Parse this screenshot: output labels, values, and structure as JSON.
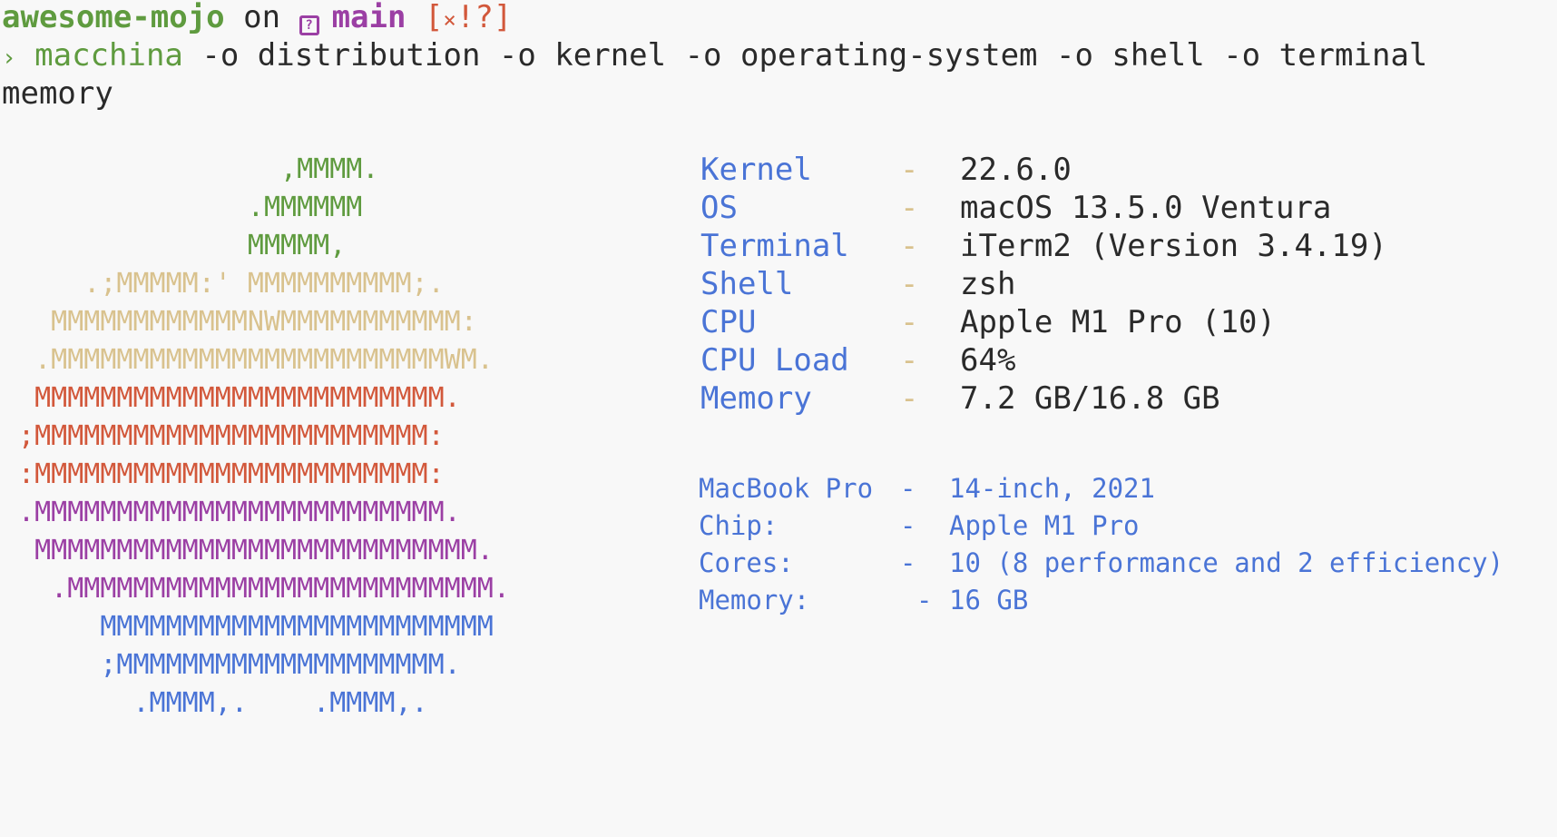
{
  "prompt": {
    "directory": "awesome-mojo",
    "on_word": "on",
    "branch_icon": "git-branch-question-icon",
    "branch_icon_glyph": "?",
    "branch": "main",
    "status_open": "[",
    "status_x": "×",
    "status_flags": "!?",
    "status_close": "]",
    "prompt_symbol": "›",
    "command": "macchina",
    "args_line1": " -o distribution -o kernel -o operating-system -o shell -o terminal",
    "args_line2": "memory"
  },
  "ascii_art": [
    {
      "text": "                 ,MMMM.",
      "color": "green"
    },
    {
      "text": "               .MMMMMM",
      "color": "green"
    },
    {
      "text": "               MMMMM,",
      "color": "green"
    },
    {
      "text": "     .;MMMMM:' MMMMMMMMMM;.",
      "color": "yellow"
    },
    {
      "text": "   MMMMMMMMMMMMNWMMMMMMMMMMM:",
      "color": "yellow"
    },
    {
      "text": "  .MMMMMMMMMMMMMMMMMMMMMMMMWM.",
      "color": "yellow"
    },
    {
      "text": "  MMMMMMMMMMMMMMMMMMMMMMMMM.",
      "color": "red"
    },
    {
      "text": " ;MMMMMMMMMMMMMMMMMMMMMMMM:",
      "color": "red"
    },
    {
      "text": " :MMMMMMMMMMMMMMMMMMMMMMMM:",
      "color": "red"
    },
    {
      "text": " .MMMMMMMMMMMMMMMMMMMMMMMMM.",
      "color": "purple"
    },
    {
      "text": "  MMMMMMMMMMMMMMMMMMMMMMMMMMM.",
      "color": "purple"
    },
    {
      "text": "   .MMMMMMMMMMMMMMMMMMMMMMMMMM.",
      "color": "purple"
    },
    {
      "text": "      MMMMMMMMMMMMMMMMMMMMMMMM",
      "color": "blue"
    },
    {
      "text": "      ;MMMMMMMMMMMMMMMMMMMM.",
      "color": "blue"
    },
    {
      "text": "        .MMMM,.    .MMMM,.",
      "color": "blue"
    }
  ],
  "info": [
    {
      "key": "Kernel",
      "sep": "-",
      "value": "22.6.0"
    },
    {
      "key": "OS",
      "sep": "-",
      "value": "macOS 13.5.0 Ventura"
    },
    {
      "key": "Terminal",
      "sep": "-",
      "value": "iTerm2 (Version 3.4.19)"
    },
    {
      "key": "Shell",
      "sep": "-",
      "value": "zsh"
    },
    {
      "key": "CPU",
      "sep": "-",
      "value": "Apple M1 Pro (10)"
    },
    {
      "key": "CPU Load",
      "sep": "-",
      "value": "64%"
    },
    {
      "key": "Memory",
      "sep": "-",
      "value": "7.2 GB/16.8 GB"
    }
  ],
  "hardware": [
    {
      "key": "MacBook Pro",
      "sep": "-",
      "value": "14-inch, 2021"
    },
    {
      "key": "Chip:",
      "sep": "-",
      "value": "Apple M1 Pro"
    },
    {
      "key": "Cores:",
      "sep": "-",
      "value": "10 (8 performance and 2 efficiency)"
    },
    {
      "key": "Memory:",
      "sep": "-",
      "value": "16 GB"
    }
  ],
  "colors": {
    "green": "#5f9b3f",
    "yellow": "#d9c28e",
    "red": "#d2583b",
    "purple": "#9b3fa4",
    "blue": "#4a74d6"
  }
}
